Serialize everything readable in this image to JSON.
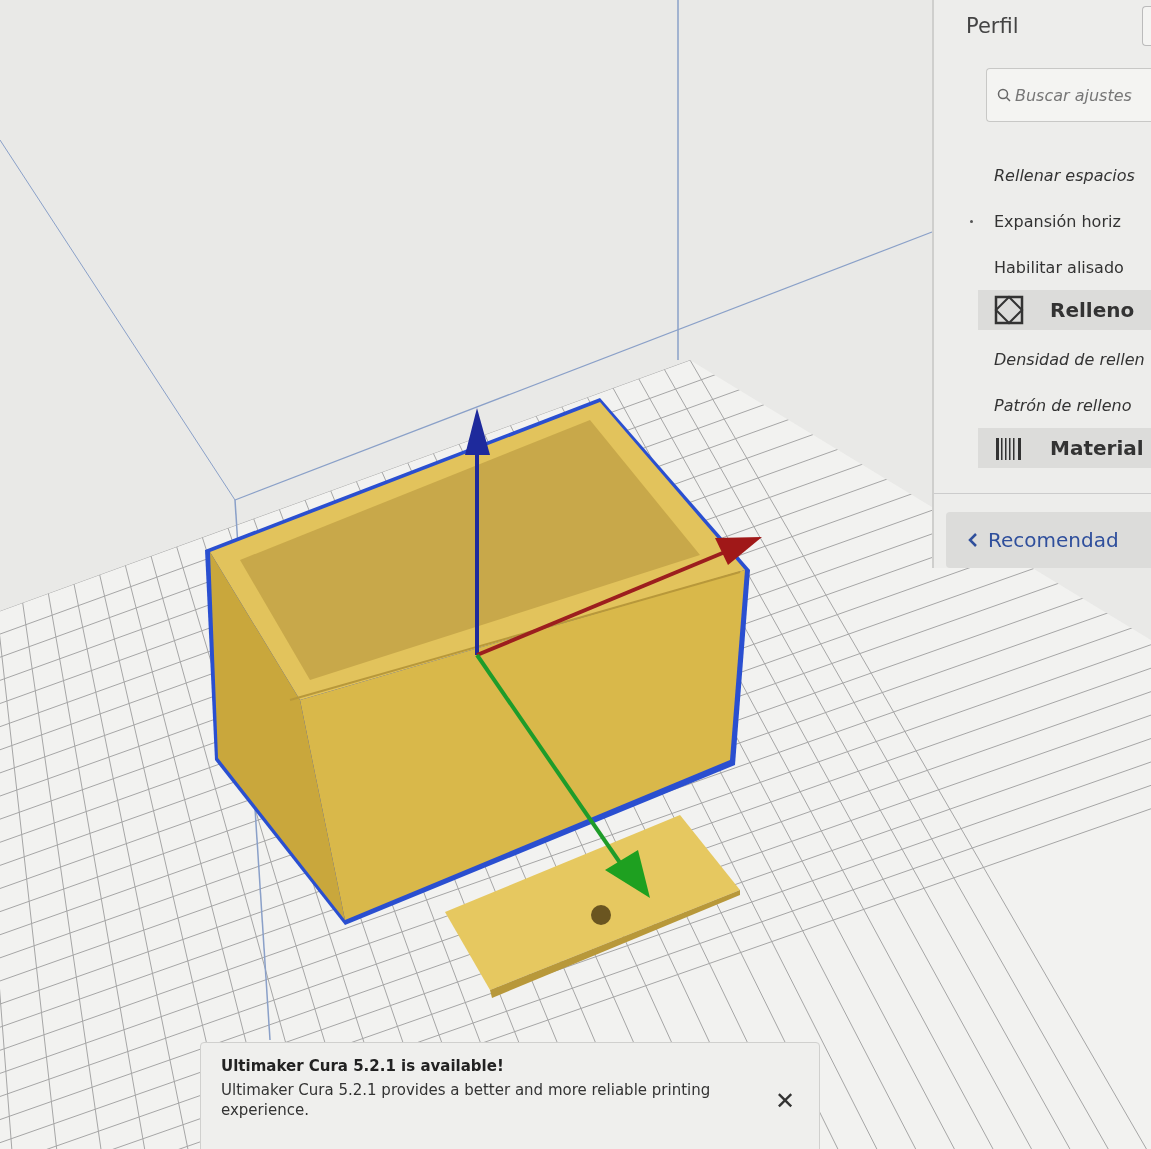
{
  "settings_panel": {
    "title": "Perfil",
    "search": {
      "placeholder": "Buscar ajustes"
    },
    "items": [
      {
        "kind": "setting",
        "label": "Rellenar espacios",
        "italic": true,
        "marked": false
      },
      {
        "kind": "setting",
        "label": "Expansión horiz",
        "italic": false,
        "marked": true
      },
      {
        "kind": "setting",
        "label": "Habilitar alisado",
        "italic": false,
        "marked": false
      },
      {
        "kind": "category",
        "label": "Relleno"
      },
      {
        "kind": "setting",
        "label": "Densidad de rellen",
        "italic": true,
        "marked": false
      },
      {
        "kind": "setting",
        "label": "Patrón de relleno",
        "italic": true,
        "marked": false
      },
      {
        "kind": "category",
        "label": "Material"
      }
    ],
    "back_button": {
      "label": "Recomendad"
    }
  },
  "notification": {
    "title": "Ultimaker Cura 5.2.1 is available!",
    "message": "Ultimaker Cura 5.2.1 provides a better and more reliable printing experience.",
    "close": "✕"
  }
}
